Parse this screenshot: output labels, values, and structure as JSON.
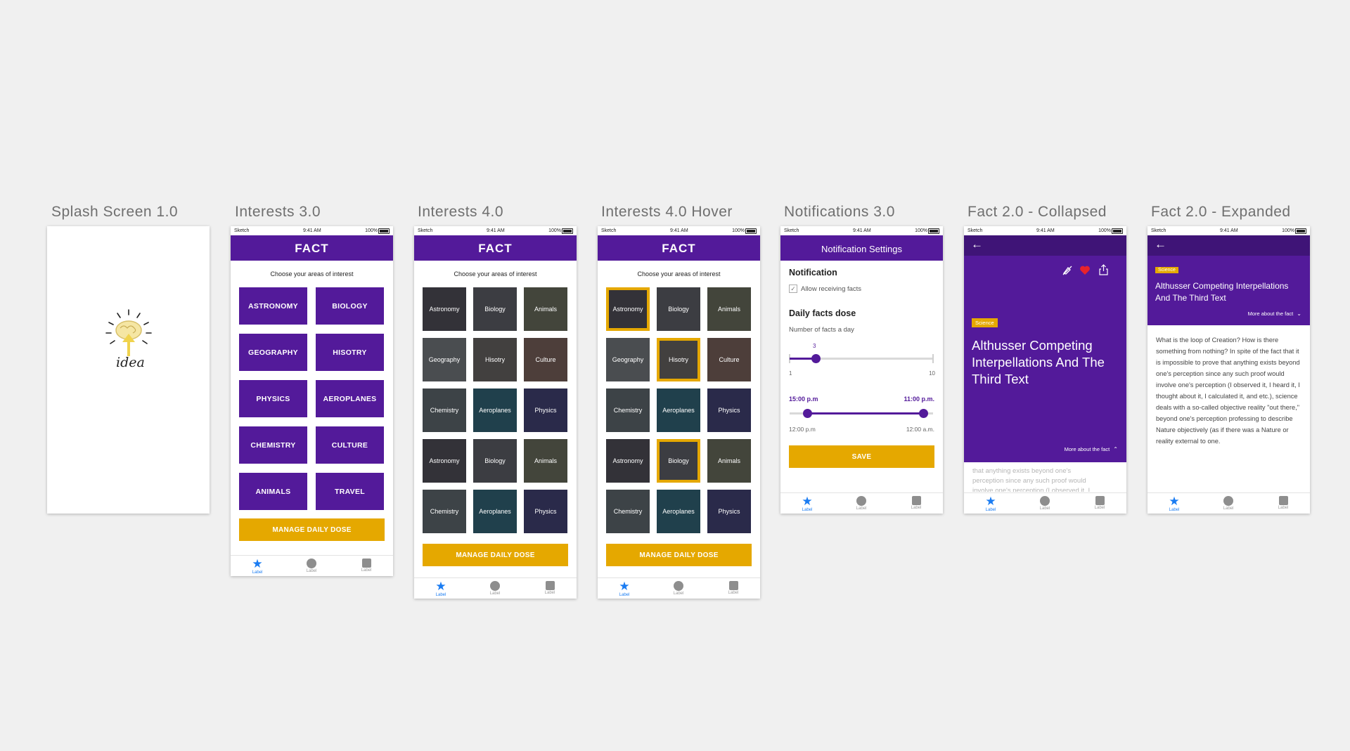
{
  "artboards": [
    {
      "title": "Splash Screen 1.0"
    },
    {
      "title": "Interests 3.0"
    },
    {
      "title": "Interests 4.0"
    },
    {
      "title": "Interests 4.0 Hover"
    },
    {
      "title": "Notifications 3.0"
    },
    {
      "title": "Fact 2.0 - Collapsed"
    },
    {
      "title": "Fact 2.0 - Expanded"
    }
  ],
  "status": {
    "carrier": "Sketch",
    "time": "9:41 AM",
    "battery": "100%"
  },
  "splash": {
    "logo_text": "idea"
  },
  "interests": {
    "brand": "FACT",
    "subtitle": "Choose your areas of interest",
    "tiles": [
      "ASTRONOMY",
      "BIOLOGY",
      "GEOGRAPHY",
      "HISOTRY",
      "PHYSICS",
      "AEROPLANES",
      "CHEMISTRY",
      "CULTURE",
      "ANIMALS",
      "TRAVEL"
    ],
    "photo_tiles": [
      "Astronomy",
      "Biology",
      "Animals",
      "Geography",
      "Hisotry",
      "Culture",
      "Chemistry",
      "Aeroplanes",
      "Physics",
      "Astronomy",
      "Biology",
      "Animals",
      "Chemistry",
      "Aeroplanes",
      "Physics"
    ],
    "cta": "MANAGE DAILY DOSE"
  },
  "tabs": {
    "active_label": "Label",
    "label_2": "Label",
    "label_3": "Label"
  },
  "notifications": {
    "header": "Notification Settings",
    "section_notification": "Notification",
    "allow_label": "Allow receiving facts",
    "allow_checked": true,
    "section_dose": "Daily facts dose",
    "dose_caption": "Number of facts a day",
    "dose_value": "3",
    "dose_min": "1",
    "dose_max": "10",
    "time_start": "15:00 p.m",
    "time_end": "11:00 p.m.",
    "range_min": "12:00 p.m",
    "range_max": "12:00 a.m.",
    "save": "SAVE"
  },
  "fact": {
    "tag": "Science",
    "title": "Althusser Competing Interpellations And The Third Text",
    "more": "More about the fact",
    "peek_1": "that anything exists beyond one's",
    "peek_2": "perception since any such proof would",
    "peek_3": "involve one's perception (I observed it, I",
    "body": "What is the loop of Creation? How is there something from nothing? In spite of the fact that it is impossible to prove that anything exists beyond one's perception since any such proof would involve one's perception (I observed it, I heard it, I thought about it, I calculated it, and etc.), science deals with a so-called objective reality \"out there,\" beyond one's perception professing to describe Nature objectively (as if there was a Nature or reality external to one."
  },
  "colors": {
    "purple": "#531a9a",
    "amber": "#e5a800",
    "blue": "#1a7cf2",
    "background": "#f0f0f0"
  }
}
